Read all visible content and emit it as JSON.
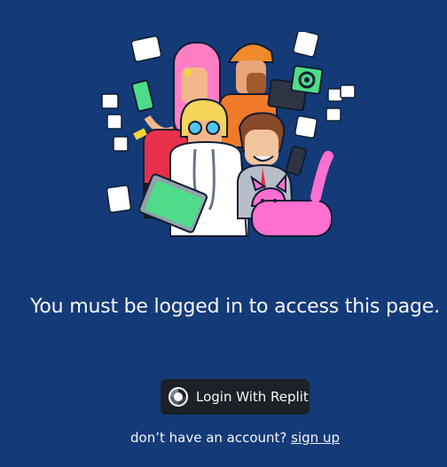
{
  "main": {
    "illustration_icon": "people-with-devices-illustration",
    "message": "You must be logged in to access this page.",
    "login_button_label": "Login With Replit",
    "login_button_icon": "replit-logo-icon",
    "signup_prompt": "don’t have an account?",
    "signup_link": "sign up"
  },
  "colors": {
    "background": "#143a78",
    "button_bg": "#1c2027",
    "text": "#f5f6f8"
  }
}
